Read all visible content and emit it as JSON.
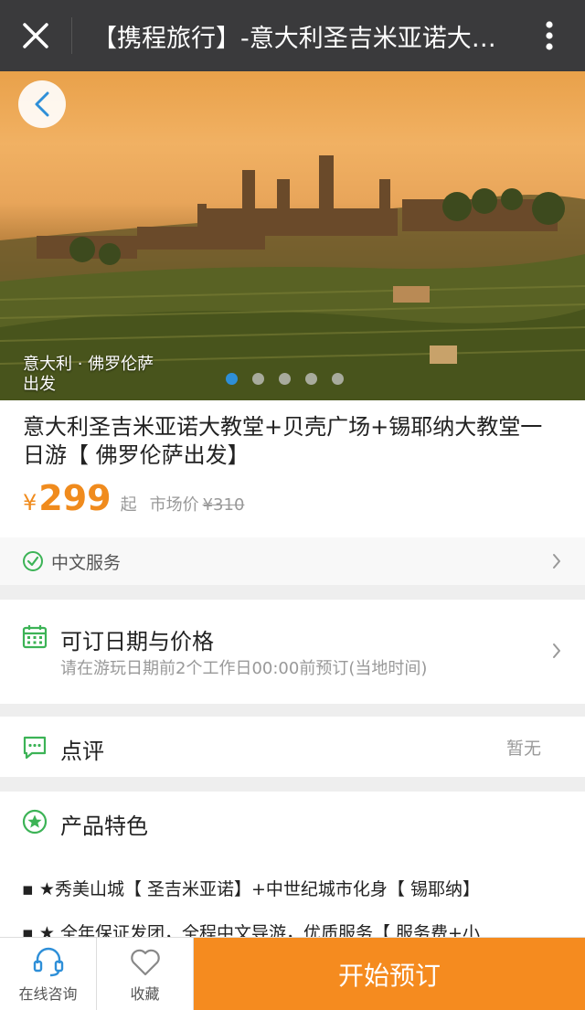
{
  "nav": {
    "title": "【携程旅行】-意大利圣吉米亚诺大教堂+贝壳广场+锡耶纳大教堂一日游",
    "close_icon": "close-icon",
    "more_icon": "more-vertical-icon"
  },
  "hero": {
    "caption": "意大利 · 佛罗伦萨出发",
    "slide_count": 5,
    "active_slide": 1
  },
  "product": {
    "name": "意大利圣吉米亚诺大教堂+贝壳广场+锡耶纳大教堂一日游【 佛罗伦萨出发】",
    "currency": "¥",
    "price": "299",
    "price_suffix": "起",
    "market_label": "市场价",
    "market_price": "¥310"
  },
  "service": {
    "label": "中文服务"
  },
  "dates": {
    "title": "可订日期与价格",
    "note": "请在游玩日期前2个工作日00:00前预订(当地时间)"
  },
  "review": {
    "title": "点评",
    "value": "暂无"
  },
  "features": {
    "title": "产品特色",
    "items": [
      "★秀美山城【 圣吉米亚诺】+中世纪城市化身【 锡耶纳】",
      "★ 全年保证发团，全程中文导游，优质服务【 服务费+小"
    ]
  },
  "bottom": {
    "consult_label": "在线咨询",
    "favorite_label": "收藏",
    "book_label": "开始预订"
  },
  "colors": {
    "accent": "#f58b1f",
    "green": "#3cb356",
    "dot_active": "#2e8fd8"
  }
}
